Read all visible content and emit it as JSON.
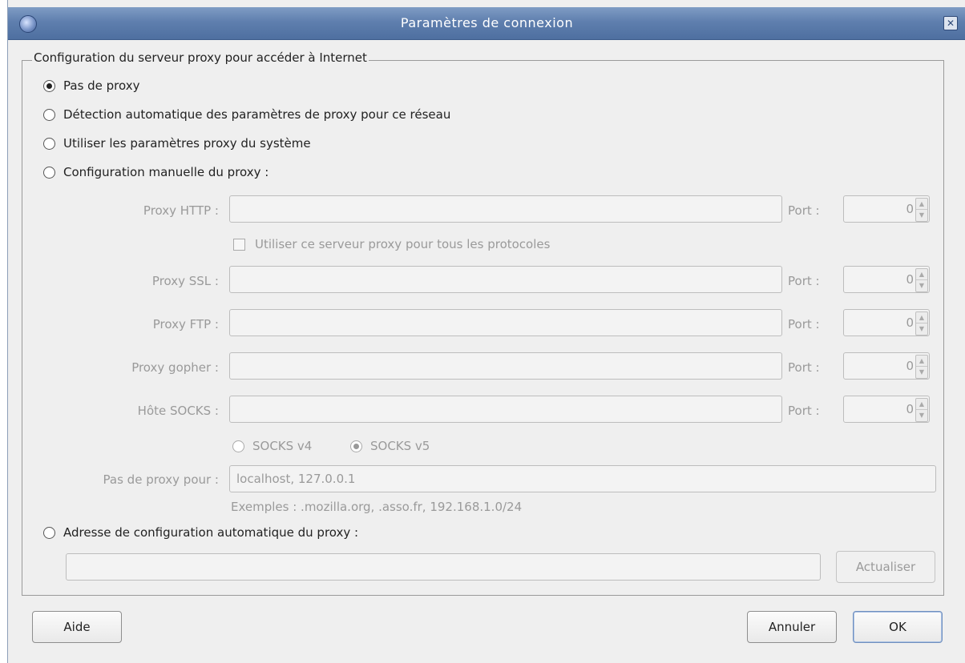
{
  "window": {
    "title": "Paramètres de connexion"
  },
  "group": {
    "legend": "Configuration du serveur proxy pour accéder à Internet"
  },
  "options": {
    "no_proxy": "Pas de proxy",
    "auto_detect": "Détection automatique des paramètres de proxy pour ce réseau",
    "system": "Utiliser les paramètres proxy du système",
    "manual": "Configuration manuelle du proxy :",
    "auto_url": "Adresse de configuration automatique du proxy :"
  },
  "selected_option": "Pas de proxy",
  "manual": {
    "http_label": "Proxy HTTP :",
    "http_value": "",
    "http_port": "0",
    "use_for_all": "Utiliser ce serveur proxy pour tous les protocoles",
    "use_for_all_checked": false,
    "ssl_label": "Proxy SSL :",
    "ssl_value": "",
    "ssl_port": "0",
    "ftp_label": "Proxy FTP :",
    "ftp_value": "",
    "ftp_port": "0",
    "gopher_label": "Proxy gopher :",
    "gopher_value": "",
    "gopher_port": "0",
    "socks_label": "Hôte SOCKS :",
    "socks_value": "",
    "socks_port": "0",
    "port_label": "Port :",
    "socks_v4": "SOCKS v4",
    "socks_v5": "SOCKS v5",
    "socks_selected": "SOCKS v5",
    "no_proxy_for_label": "Pas de proxy pour :",
    "no_proxy_for_value": "localhost, 127.0.0.1",
    "examples": "Exemples : .mozilla.org, .asso.fr, 192.168.1.0/24"
  },
  "auto_config": {
    "url_value": "",
    "reload_label": "Actualiser"
  },
  "buttons": {
    "help": "Aide",
    "cancel": "Annuler",
    "ok": "OK"
  }
}
